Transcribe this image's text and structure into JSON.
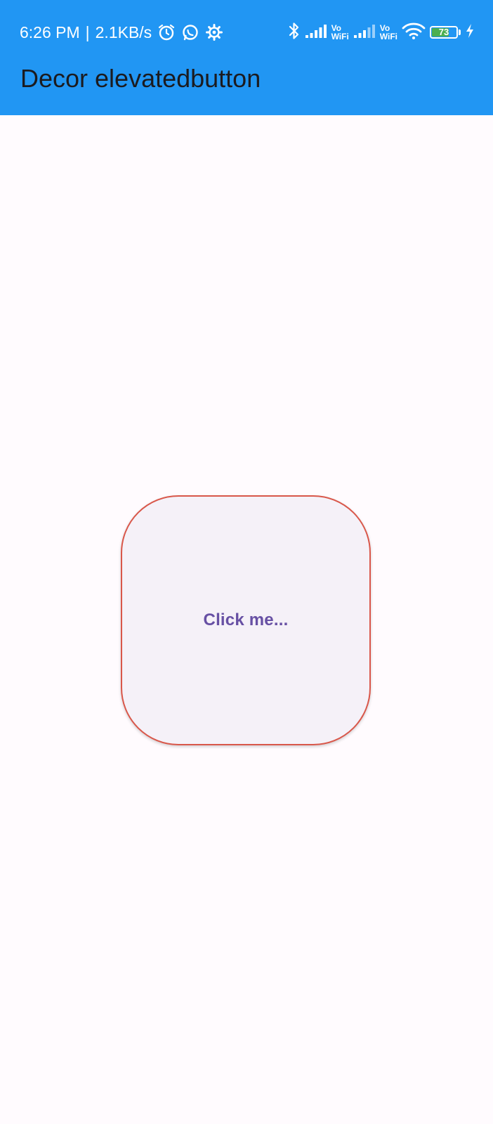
{
  "status_bar": {
    "time": "6:26 PM",
    "separator": "|",
    "net_speed": "2.1KB/s",
    "left_icons": [
      "alarm-icon",
      "whatsapp-icon",
      "settings-gear-icon"
    ],
    "right_icons": [
      "bluetooth-icon",
      "signal-bars-icon",
      "vowifi-icon",
      "signal-bars-icon",
      "vowifi-icon",
      "wifi-icon",
      "battery-icon",
      "charging-bolt-icon"
    ],
    "vowifi_top": "Vo",
    "vowifi_bottom": "WiFi",
    "battery_level": "73",
    "battery_fraction": 0.73,
    "background_color": "#2196f3"
  },
  "app_bar": {
    "title": "Decor elevatedbutton",
    "background_color": "#2196f3"
  },
  "main": {
    "button": {
      "label": "Click me...",
      "border_color": "#d9574a",
      "label_color": "#6750a4",
      "fill_color": "#f5f1f8"
    }
  }
}
